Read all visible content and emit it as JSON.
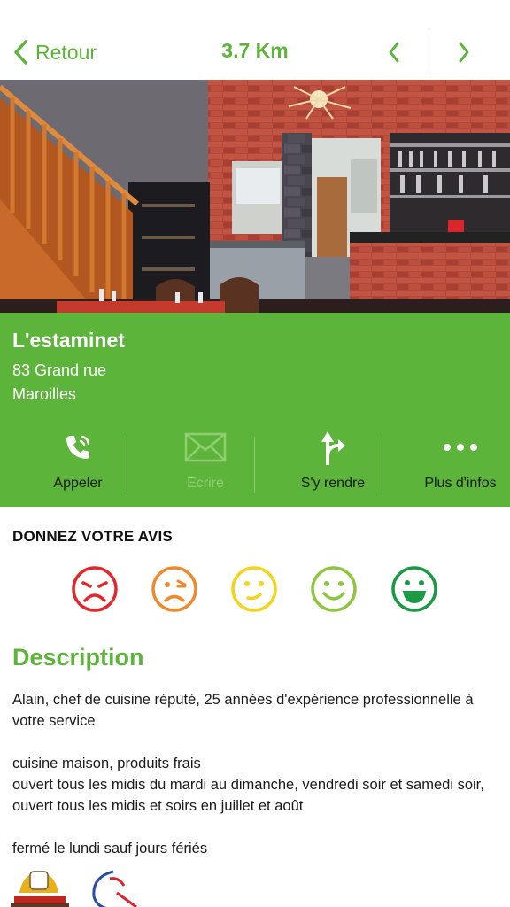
{
  "header": {
    "back_label": "Retour",
    "distance": "3.7 Km"
  },
  "restaurant": {
    "name": "L'estaminet",
    "address_line1": "83 Grand rue",
    "address_line2": "Maroilles"
  },
  "actions": [
    {
      "label": "Appeler",
      "icon": "phone-icon",
      "enabled": true
    },
    {
      "label": "Ecrire",
      "icon": "envelope-icon",
      "enabled": false
    },
    {
      "label": "S'y rendre",
      "icon": "directions-icon",
      "enabled": true
    },
    {
      "label": "Plus d'infos",
      "icon": "more-dots-icon",
      "enabled": true
    }
  ],
  "review": {
    "title": "DONNEZ VOTRE AVIS",
    "ratings": [
      {
        "icon": "very-unhappy-face-icon",
        "color": "#e3262b"
      },
      {
        "icon": "unhappy-face-icon",
        "color": "#ef8a2c"
      },
      {
        "icon": "neutral-face-icon",
        "color": "#f4d31d"
      },
      {
        "icon": "happy-face-icon",
        "color": "#8dc63f"
      },
      {
        "icon": "very-happy-face-icon",
        "color": "#1a9a44"
      }
    ]
  },
  "description": {
    "title": "Description",
    "p1": "Alain, chef de cuisine réputé, 25 années d'expérience professionnelle à votre service",
    "p2a": "cuisine maison, produits frais",
    "p2b": "ouvert tous les midis du mardi au dimanche, vendredi soir et samedi soir, ouvert tous les midis et soirs en juillet et août",
    "p3": "fermé le lundi sauf jours fériés"
  },
  "colors": {
    "accent": "#5db43a",
    "disabled_label": "#8fcf72"
  }
}
